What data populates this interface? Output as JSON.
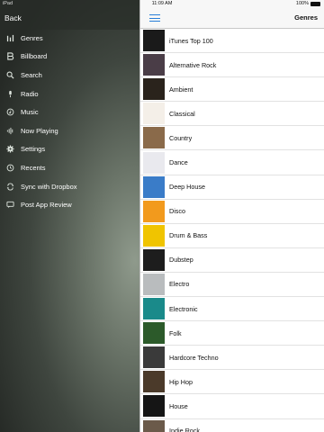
{
  "status": {
    "device": "iPad",
    "time": "11:09 AM",
    "battery": "100%"
  },
  "sidemenu": {
    "back_label": "Back",
    "items": [
      {
        "label": "Genres",
        "icon": "equalizer-icon"
      },
      {
        "label": "Billboard",
        "icon": "billboard-icon"
      },
      {
        "label": "Search",
        "icon": "search-icon"
      },
      {
        "label": "Radio",
        "icon": "microphone-icon"
      },
      {
        "label": "Music",
        "icon": "music-note-icon"
      },
      {
        "label": "Now Playing",
        "icon": "waveform-icon"
      },
      {
        "label": "Settings",
        "icon": "gear-icon"
      },
      {
        "label": "Recents",
        "icon": "history-icon"
      },
      {
        "label": "Sync with Dropbox",
        "icon": "dropbox-icon"
      },
      {
        "label": "Post App Review",
        "icon": "chat-icon"
      }
    ]
  },
  "navbar": {
    "title": "Genres"
  },
  "genres": [
    {
      "label": "iTunes Top 100",
      "color": "#1a1a1a"
    },
    {
      "label": "Alternative Rock",
      "color": "#4a3d47"
    },
    {
      "label": "Ambient",
      "color": "#2a231c"
    },
    {
      "label": "Classical",
      "color": "#f4efe8"
    },
    {
      "label": "Country",
      "color": "#8a6a4a"
    },
    {
      "label": "Dance",
      "color": "#e9e9ee"
    },
    {
      "label": "Deep House",
      "color": "#3a7cc8"
    },
    {
      "label": "Disco",
      "color": "#f29a1d"
    },
    {
      "label": "Drum & Bass",
      "color": "#f0c400"
    },
    {
      "label": "Dubstep",
      "color": "#1d1d1d"
    },
    {
      "label": "Electro",
      "color": "#b9bcbe"
    },
    {
      "label": "Electronic",
      "color": "#1a8a8a"
    },
    {
      "label": "Folk",
      "color": "#2c5a2a"
    },
    {
      "label": "Hardcore Techno",
      "color": "#3a3a3a"
    },
    {
      "label": "Hip Hop",
      "color": "#4b3a2a"
    },
    {
      "label": "House",
      "color": "#151515"
    },
    {
      "label": "Indie Rock",
      "color": "#6b5a4a"
    }
  ]
}
